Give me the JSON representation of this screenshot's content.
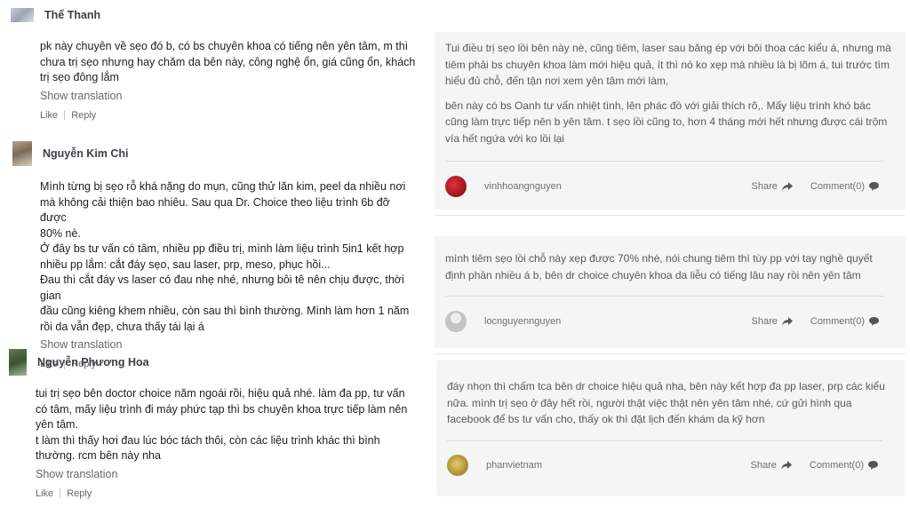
{
  "left_comments": [
    {
      "name": "Thể Thanh",
      "body": "pk này chuyên về sẹo đó b, có bs chuyên khoa có tiếng nên yên tâm, m thì\nchưa trị sẹo nhưng hay chăm da bên này, công nghệ ổn, giá cũng ổn, khách\ntrị sẹo đông lắm",
      "translate": "Show translation",
      "like": "Like",
      "reply": "Reply"
    },
    {
      "name": "Nguyễn Kim Chi",
      "body": "Mình từng bị sẹo rỗ khá nặng do mụn, cũng thử lăn kim, peel da nhiều nơi\nmà không cải thiện bao nhiêu. Sau qua Dr. Choice theo liệu trình 6b đỡ được\n80% nè.\nỞ đây bs tư vấn có tâm, nhiều pp điều trị, mình làm liệu trình 5in1 kết hợp\nnhiều pp lắm: cắt đáy sẹo, sau laser, prp, meso, phục hồi...\nĐau thì cắt đáy vs laser có đau nhẹ nhé, nhưng bôi tê nên chịu được, thời gian\nđầu cũng kiêng khem nhiều, còn sau thì bình thường. Mình làm hơn 1 năm\nrồi da vẫn đẹp, chưa thấy tái lại á",
      "translate": "Show translation",
      "like": "Like",
      "reply": "Reply"
    },
    {
      "name": "Nguyễn Phương Hoa",
      "body": "tui trị sẹo bên doctor choice năm ngoái rồi, hiệu quả nhé. làm đa pp, tư vấn\ncó tâm, mấy liệu trình đi máy phức tạp thì bs chuyên khoa trực tiếp làm nên\nyên tâm.\nt làm thì thấy hơi đau lúc bóc tách thôi, còn các liệu trình khác thì bình\nthường. rcm bên này nha",
      "translate": "Show translation",
      "like": "Like",
      "reply": "Reply"
    }
  ],
  "right_cards": [
    {
      "paragraphs": [
        "Tui điều trị sẹo lồi bên này nè, cũng tiêm, laser sau băng ép với bôi thoa các kiểu á, nhưng mà tiêm phải bs chuyên khoa làm mới hiệu quả, ít thì nó ko xẹp mà nhiều là bị lõm á, tui trước tìm hiểu đủ chỗ, đến tận nơi xem yên tâm mới làm,",
        "bên này có bs Oanh tư vấn nhiệt tình, lên phác đồ với giải thích rõ,. Mấy liệu trình khó bác cũng làm trực tiếp nên b yên tâm. t sẹo lồi cũng to, hơn 4 tháng mới hết nhưng được cái trộm vía hết ngứa với ko lồi lại"
      ],
      "user": "vinhhoangnguyen",
      "share": "Share",
      "comment": "Comment(0)",
      "avatar_color": "#b3121d"
    },
    {
      "paragraphs": [
        "mình tiêm sẹo lồi chỗ này xẹp được 70% nhé, nói chung tiêm thì tùy pp với tay nghề quyết định phần nhiều á b, bên dr choice chuyên khoa da liễu có tiếng lâu nay rồi nên yên tâm"
      ],
      "user": "locnguyennguyen",
      "share": "Share",
      "comment": "Comment(0)",
      "avatar_color": "#cfcfcf"
    },
    {
      "paragraphs": [
        "đáy nhọn thì chấm tca bên dr choice hiệu quả nha, bên này kết hợp đa pp laser, prp các kiểu nữa. mình trị sẹo ở đây hết rồi, người thật việc thật nên yên tâm nhé, cứ gửi hình qua facebook để bs tư vấn cho, thấy ok thì đặt lịch đến khám da kỹ hơn"
      ],
      "user": "phanvietnam",
      "share": "Share",
      "comment": "Comment(0)",
      "avatar_color": "#c8a94a"
    }
  ]
}
